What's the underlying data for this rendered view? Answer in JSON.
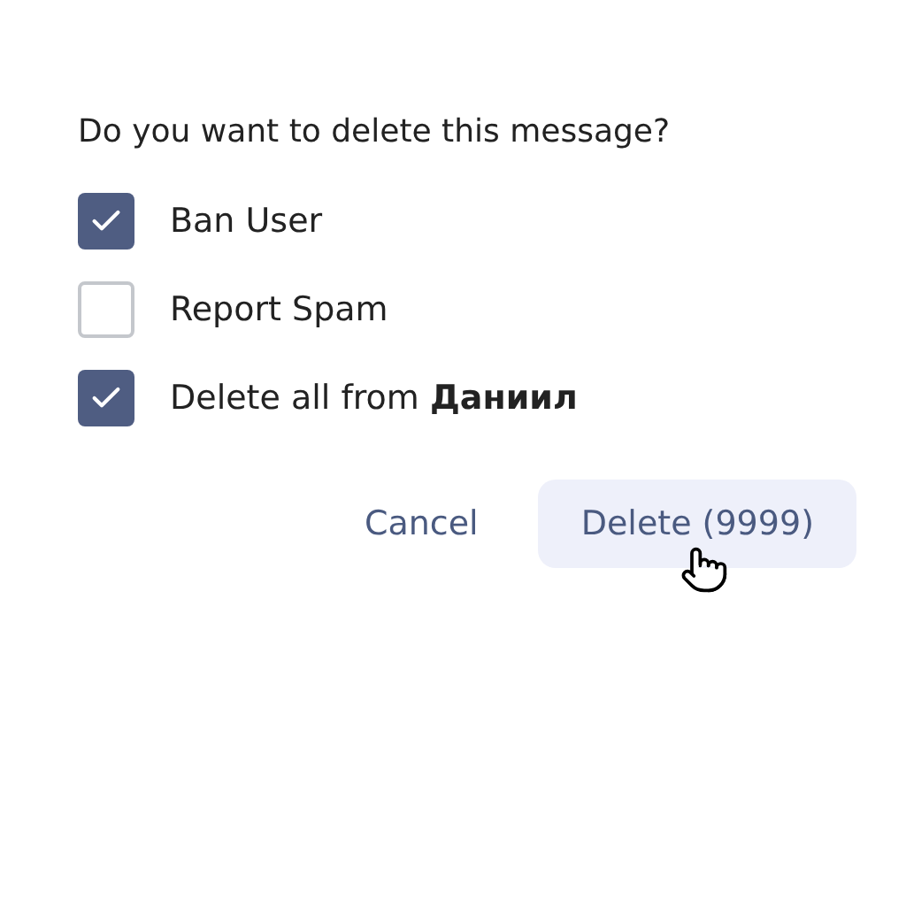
{
  "dialog": {
    "question": "Do you want to delete this message?",
    "options": [
      {
        "label": "Ban User",
        "checked": true
      },
      {
        "label": "Report Spam",
        "checked": false
      },
      {
        "label": "Delete all from **Даниил**",
        "checked": true
      }
    ],
    "buttons": [
      {
        "label": "Cancel",
        "kind": "secondary"
      },
      {
        "label": "Delete (9999)",
        "kind": "primary"
      }
    ]
  }
}
